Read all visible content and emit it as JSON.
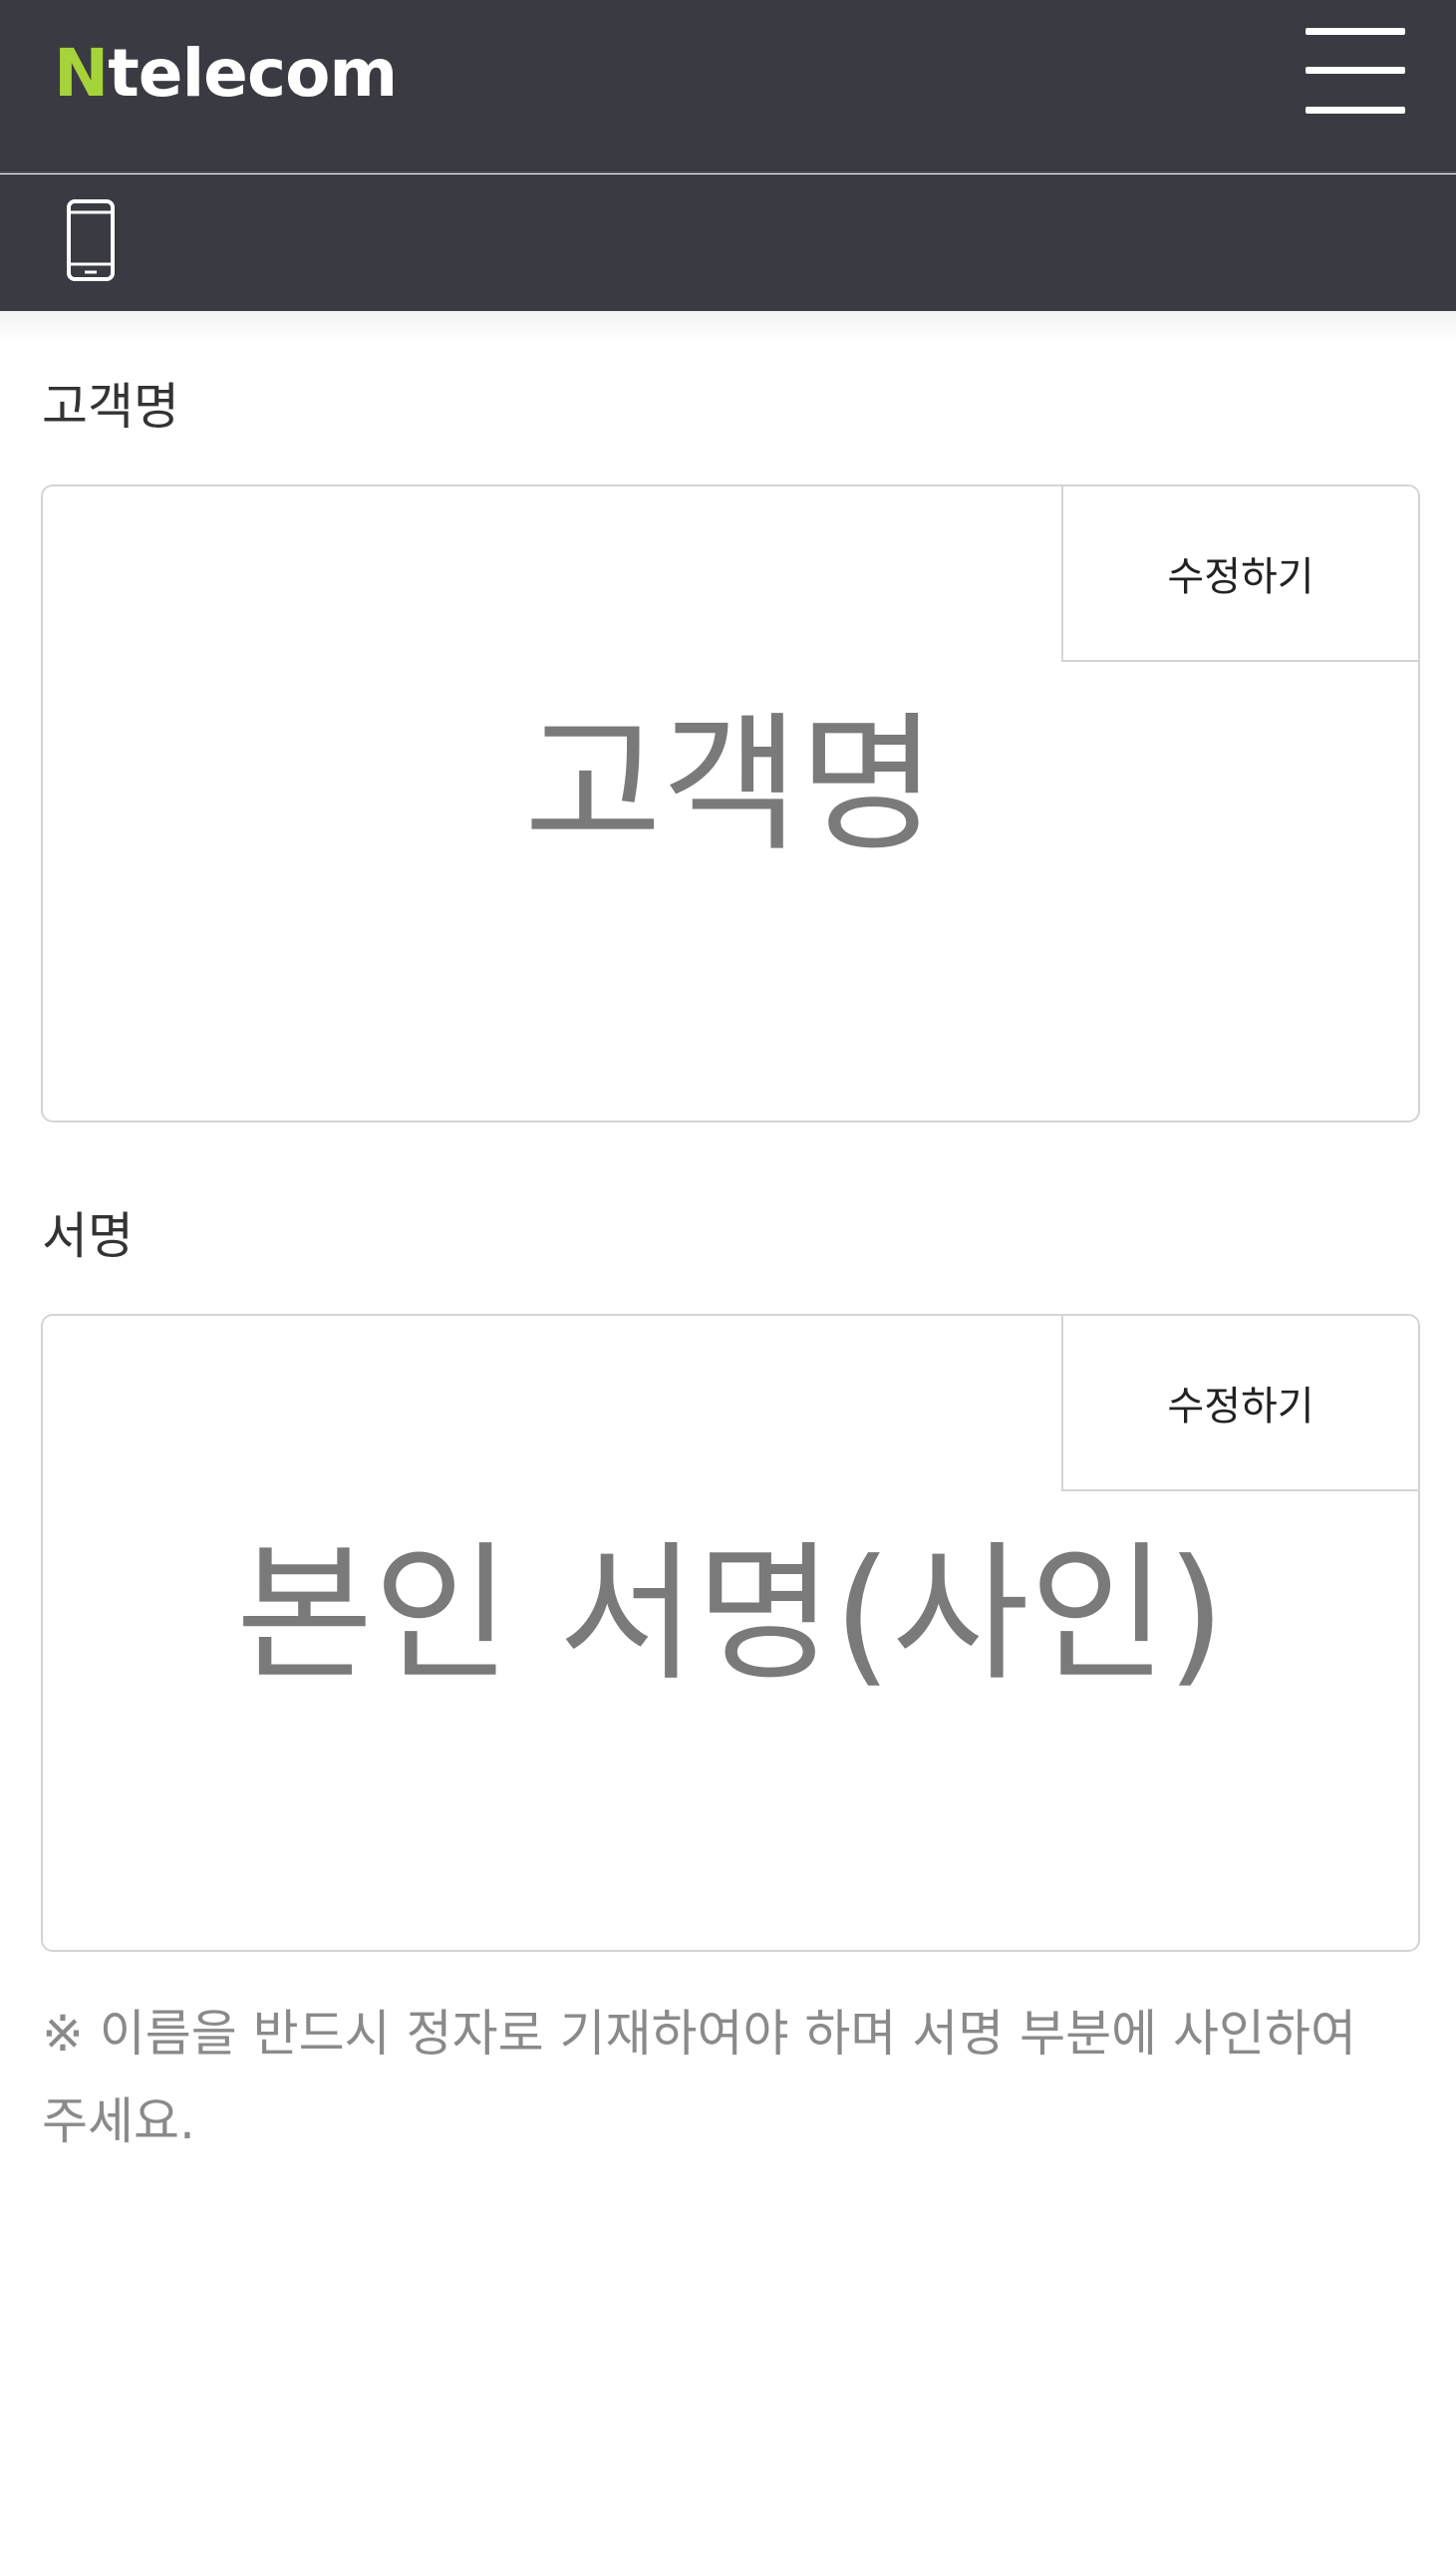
{
  "header": {
    "logo_n": "N",
    "logo_rest": "telecom",
    "menu_icon": "hamburger-menu-icon"
  },
  "subbar": {
    "icon": "mobile-phone-icon"
  },
  "customer_section": {
    "label": "고객명",
    "edit_label": "수정하기",
    "display_text": "고객명"
  },
  "signature_section": {
    "label": "서명",
    "edit_label": "수정하기",
    "display_text": "본인 서명(사인)"
  },
  "note": "※ 이름을 반드시 정자로 기재하여야 하며 서명 부분에 사인하여 주세요.",
  "colors": {
    "header_bg": "#3a3a42",
    "logo_accent": "#a6d33a",
    "placeholder_text": "#7a7a7a",
    "note_text": "#8a8a8a"
  }
}
